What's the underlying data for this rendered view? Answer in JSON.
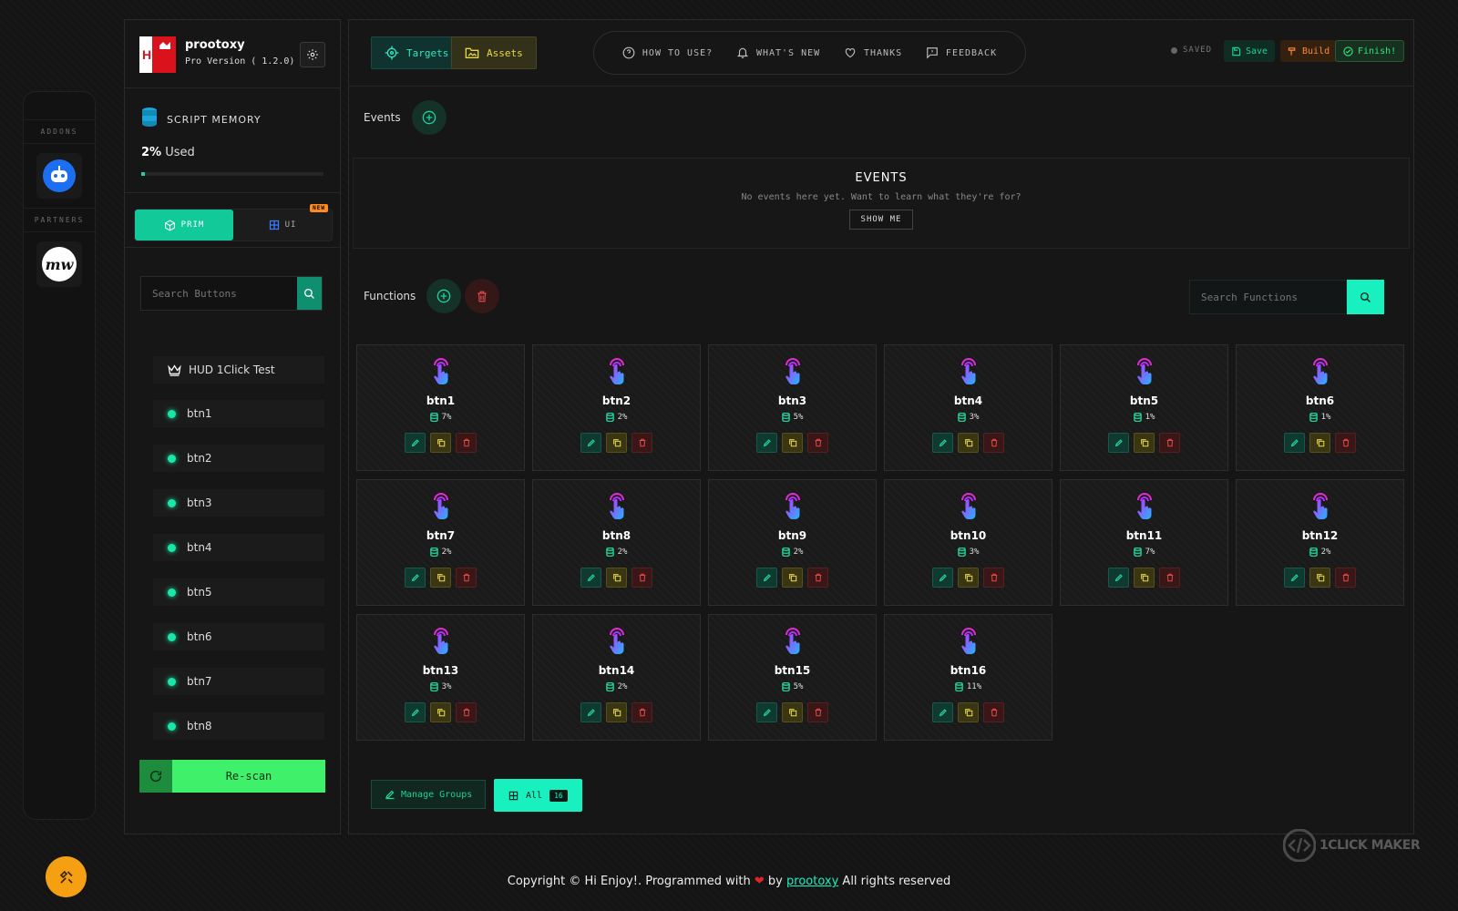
{
  "rail": {
    "addons_label": "ADDONS",
    "partners_label": "PARTNERS",
    "partner_text": "mw"
  },
  "app": {
    "name": "prootoxy",
    "version": "Pro Version ( 1.2.0)"
  },
  "memory": {
    "title": "SCRIPT MEMORY",
    "used_pct": "2%",
    "used_label": "Used",
    "used_fraction": 0.02
  },
  "tabs": {
    "prim": "PRIM",
    "ui": "UI",
    "new_badge": "NEW"
  },
  "button_search": {
    "placeholder": "Search Buttons"
  },
  "button_list": {
    "hud": "HUD 1Click Test",
    "items": [
      "btn1",
      "btn2",
      "btn3",
      "btn4",
      "btn5",
      "btn6",
      "btn7",
      "btn8"
    ]
  },
  "rescan_label": "Re-scan",
  "topbar": {
    "targets": "Targets",
    "assets": "Assets",
    "nav": [
      "HOW TO USE?",
      "WHAT'S NEW",
      "THANKS",
      "FEEDBACK"
    ],
    "status": "SAVED",
    "save": "Save",
    "build": "Build",
    "finish": "Finish!"
  },
  "events": {
    "label": "Events",
    "title": "EVENTS",
    "subtitle": "No events here yet. Want to learn what they're for?",
    "show_me": "SHOW ME"
  },
  "functions": {
    "label": "Functions",
    "search_placeholder": "Search Functions",
    "cards": [
      {
        "name": "btn1",
        "pct": "7%"
      },
      {
        "name": "btn2",
        "pct": "2%"
      },
      {
        "name": "btn3",
        "pct": "5%"
      },
      {
        "name": "btn4",
        "pct": "3%"
      },
      {
        "name": "btn5",
        "pct": "1%"
      },
      {
        "name": "btn6",
        "pct": "1%"
      },
      {
        "name": "btn7",
        "pct": "2%"
      },
      {
        "name": "btn8",
        "pct": "2%"
      },
      {
        "name": "btn9",
        "pct": "2%"
      },
      {
        "name": "btn10",
        "pct": "3%"
      },
      {
        "name": "btn11",
        "pct": "7%"
      },
      {
        "name": "btn12",
        "pct": "2%"
      },
      {
        "name": "btn13",
        "pct": "3%"
      },
      {
        "name": "btn14",
        "pct": "2%"
      },
      {
        "name": "btn15",
        "pct": "5%"
      },
      {
        "name": "btn16",
        "pct": "11%"
      }
    ]
  },
  "groups": {
    "manage": "Manage Groups",
    "all": "All",
    "all_count": "16"
  },
  "watermark": "1CLICK MAKER",
  "footer": {
    "prefix": "Copyright © Hi Enjoy!. Programmed with",
    "by": "by",
    "author": "prootoxy",
    "suffix": "All rights reserved"
  },
  "colors": {
    "accent": "#19f0c0",
    "prim_tab": "#12c99a",
    "rescan": "#3ef06a",
    "fab": "#f5a013"
  }
}
